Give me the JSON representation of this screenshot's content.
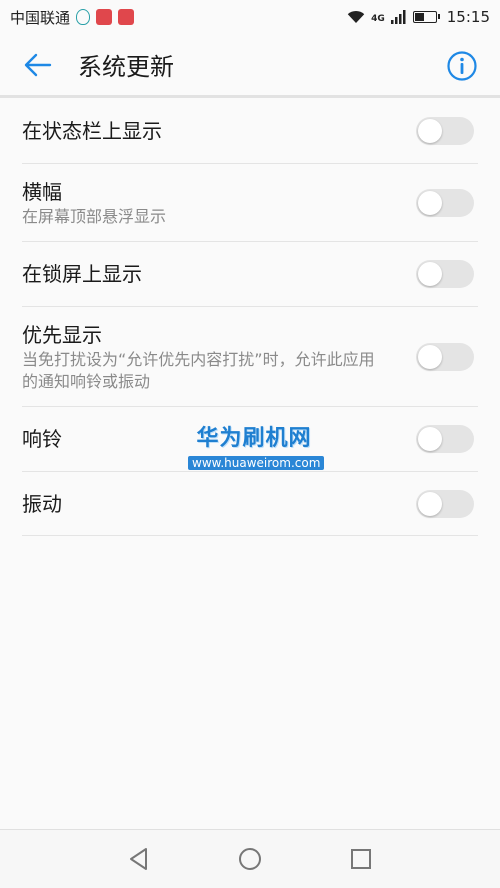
{
  "status_bar": {
    "carrier": "中国联通",
    "network": "4G",
    "time": "15:15",
    "icons": [
      "qq-icon",
      "app-notification-icon",
      "app-notification-icon",
      "wifi-icon",
      "signal-icon",
      "battery-icon"
    ]
  },
  "app_bar": {
    "title": "系统更新",
    "back_icon": "arrow-left-icon",
    "info_icon": "info-icon",
    "accent_color": "#1e88e5"
  },
  "settings": [
    {
      "title": "在状态栏上显示",
      "subtitle": "",
      "enabled": false
    },
    {
      "title": "横幅",
      "subtitle": "在屏幕顶部悬浮显示",
      "enabled": false
    },
    {
      "title": "在锁屏上显示",
      "subtitle": "",
      "enabled": false
    },
    {
      "title": "优先显示",
      "subtitle": "当免打扰设为“允许优先内容打扰”时，允许此应用的通知响铃或振动",
      "enabled": false
    },
    {
      "title": "响铃",
      "subtitle": "",
      "enabled": false
    },
    {
      "title": "振动",
      "subtitle": "",
      "enabled": false
    }
  ],
  "watermark": {
    "title": "华为刷机网",
    "url": "www.huaweirom.com"
  },
  "nav_bar": {
    "icons": [
      "nav-back-icon",
      "nav-home-icon",
      "nav-recent-icon"
    ]
  }
}
